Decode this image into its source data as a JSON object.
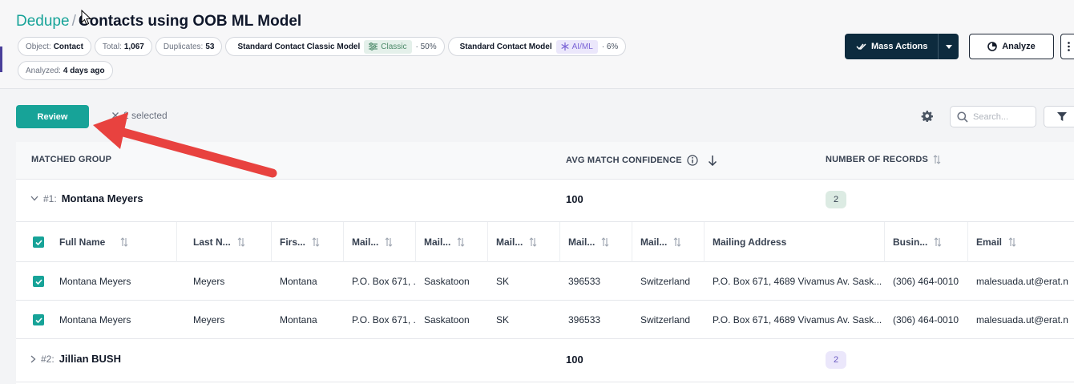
{
  "header": {
    "breadcrumb": "Dedupe",
    "separator": "/",
    "title": "Contacts using OOB ML Model",
    "chips": {
      "object_label": "Object:",
      "object_value": "Contact",
      "total_label": "Total:",
      "total_value": "1,067",
      "duplicates_label": "Duplicates:",
      "duplicates_value": "53",
      "model1_name": "Standard Contact Classic Model",
      "model1_tag": "Classic",
      "model1_pct": "· 50%",
      "model2_name": "Standard Contact Model",
      "model2_tag": "AI/ML",
      "model2_pct": "· 6%",
      "analyzed_label": "Analyzed:",
      "analyzed_value": "4 days ago"
    },
    "actions": {
      "mass_actions": "Mass Actions",
      "analyze": "Analyze"
    }
  },
  "toolbar": {
    "review": "Review",
    "selected": "2 selected",
    "search_placeholder": "Search..."
  },
  "table": {
    "columns": {
      "matched_group": "MATCHED GROUP",
      "avg_match_confidence": "AVG MATCH CONFIDENCE",
      "number_of_records": "NUMBER OF RECORDS"
    },
    "groups": [
      {
        "num": "#1:",
        "name": "Montana Meyers",
        "confidence": "100",
        "count": "2"
      },
      {
        "num": "#2:",
        "name": "Jillian BUSH",
        "confidence": "100",
        "count": "2"
      }
    ],
    "sub_columns": [
      "Full Name",
      "Last N...",
      "Firs...",
      "Mail...",
      "Mail...",
      "Mail...",
      "Mail...",
      "Mail...",
      "Mailing Address",
      "Busin...",
      "Email"
    ],
    "rows": [
      [
        "Montana Meyers",
        "Meyers",
        "Montana",
        "P.O. Box 671, ...",
        "Saskatoon",
        "SK",
        "396533",
        "Switzerland",
        "P.O. Box 671, 4689 Vivamus Av. Sask...",
        "(306) 464-0010",
        "malesuada.ut@erat.n"
      ],
      [
        "Montana Meyers",
        "Meyers",
        "Montana",
        "P.O. Box 671, ...",
        "Saskatoon",
        "SK",
        "396533",
        "Switzerland",
        "P.O. Box 671, 4689 Vivamus Av. Sask...",
        "(306) 464-0010",
        "malesuada.ut@erat.n"
      ]
    ]
  },
  "colors": {
    "accent": "#17a398",
    "navy": "#0d2b3e",
    "arrow": "#e8423f"
  }
}
